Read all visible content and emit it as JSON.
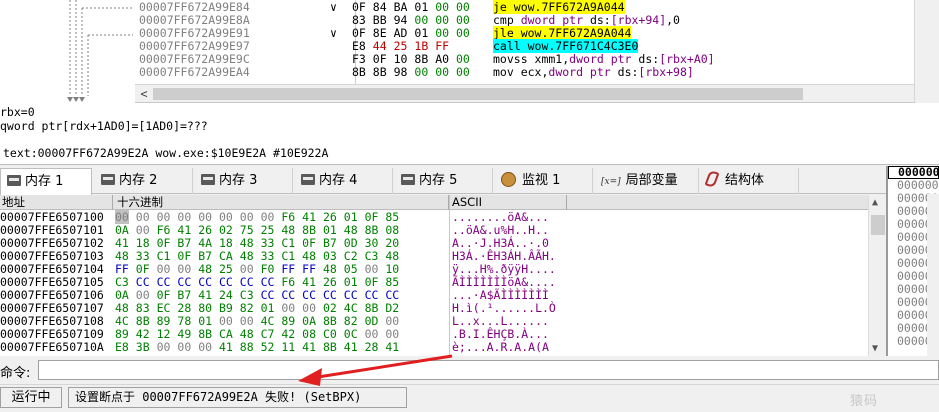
{
  "disasm": {
    "rows": [
      {
        "addr": "00007FF672A99E84",
        "arrow": "∨",
        "bytes": [
          {
            "t": "0F",
            "c": "b"
          },
          {
            "t": "84",
            "c": "b"
          },
          {
            "t": "BA",
            "c": "b"
          },
          {
            "t": "01",
            "c": "b"
          },
          {
            "t": "00",
            "c": "dz"
          },
          {
            "t": "00",
            "c": "dz"
          }
        ],
        "instr": [
          {
            "t": "je wow.7FF672A9A044",
            "c": "kw-jmp"
          }
        ]
      },
      {
        "addr": "00007FF672A99E8A",
        "arrow": "",
        "bytes": [
          {
            "t": "83",
            "c": "b"
          },
          {
            "t": "BB",
            "c": "b"
          },
          {
            "t": "94",
            "c": "b"
          },
          {
            "t": "00",
            "c": "dz"
          },
          {
            "t": "00",
            "c": "dz"
          },
          {
            "t": "00",
            "c": "dz"
          }
        ],
        "instr": [
          {
            "t": "cmp ",
            "c": ""
          },
          {
            "t": "dword ptr ",
            "c": "kw-ptr"
          },
          {
            "t": "ds:",
            "c": "kw-seg"
          },
          {
            "t": "[rbx+94]",
            "c": "kw-reg"
          },
          {
            "t": ",0",
            "c": ""
          }
        ]
      },
      {
        "addr": "00007FF672A99E91",
        "arrow": "∨",
        "bytes": [
          {
            "t": "0F",
            "c": "b"
          },
          {
            "t": "8E",
            "c": "b"
          },
          {
            "t": "AD",
            "c": "b"
          },
          {
            "t": "01",
            "c": "b"
          },
          {
            "t": "00",
            "c": "dz"
          },
          {
            "t": "00",
            "c": "dz"
          }
        ],
        "instr": [
          {
            "t": "jle wow.7FF672A9A044",
            "c": "kw-jmp"
          }
        ]
      },
      {
        "addr": "00007FF672A99E97",
        "arrow": "",
        "bytes": [
          {
            "t": "E8",
            "c": "b"
          },
          {
            "t": "44",
            "c": "hl"
          },
          {
            "t": "25",
            "c": "hl"
          },
          {
            "t": "1B",
            "c": "hl"
          },
          {
            "t": "FF",
            "c": "hl"
          }
        ],
        "instr": [
          {
            "t": "call wow.7FF671C4C3E0",
            "c": "kw-call"
          }
        ]
      },
      {
        "addr": "00007FF672A99E9C",
        "arrow": "",
        "bytes": [
          {
            "t": "F3",
            "c": "b"
          },
          {
            "t": "0F",
            "c": "b"
          },
          {
            "t": "10",
            "c": "b"
          },
          {
            "t": "8B",
            "c": "b"
          },
          {
            "t": "A0",
            "c": "b"
          },
          {
            "t": "00",
            "c": "dz"
          }
        ],
        "instr": [
          {
            "t": "movss xmm1,",
            "c": ""
          },
          {
            "t": "dword ptr ",
            "c": "kw-ptr"
          },
          {
            "t": "ds:",
            "c": "kw-seg"
          },
          {
            "t": "[rbx+A0]",
            "c": "kw-reg"
          }
        ]
      },
      {
        "addr": "00007FF672A99EA4",
        "arrow": "",
        "bytes": [
          {
            "t": "8B",
            "c": "b"
          },
          {
            "t": "8B",
            "c": "b"
          },
          {
            "t": "98",
            "c": "b"
          },
          {
            "t": "00",
            "c": "dz"
          },
          {
            "t": "00",
            "c": "dz"
          },
          {
            "t": "00",
            "c": "dz"
          }
        ],
        "instr": [
          {
            "t": "mov ecx,",
            "c": ""
          },
          {
            "t": "dword ptr ",
            "c": "kw-ptr"
          },
          {
            "t": "ds:",
            "c": "kw-seg"
          },
          {
            "t": "[rbx+98]",
            "c": "kw-reg"
          }
        ]
      }
    ],
    "scroll_left_arrow": "<"
  },
  "info": {
    "line1": "rbx=0",
    "line2": "qword ptr[rdx+1AD0]=[1AD0]=???",
    "line3": "text:00007FF672A99E2A wow.exe:$10E9E2A #10E922A"
  },
  "tabs": [
    {
      "label": "内存 1",
      "icon": "memory-icon",
      "active": true
    },
    {
      "label": "内存 2",
      "icon": "memory-icon",
      "active": false
    },
    {
      "label": "内存 3",
      "icon": "memory-icon",
      "active": false
    },
    {
      "label": "内存 4",
      "icon": "memory-icon",
      "active": false
    },
    {
      "label": "内存 5",
      "icon": "memory-icon",
      "active": false
    },
    {
      "label": "监视 1",
      "icon": "watch-icon",
      "active": false
    },
    {
      "label": "局部变量",
      "icon": "local-vars-icon",
      "active": false
    },
    {
      "label": "结构体",
      "icon": "struct-icon",
      "active": false
    }
  ],
  "tab_local_icon_text": "[x=]",
  "dump": {
    "headers": {
      "address": "地址",
      "hex": "十六进制",
      "ascii": "ASCII"
    },
    "rows": [
      {
        "addr": "00007FFE6507100",
        "hex": [
          "00",
          "00",
          "00",
          "00",
          "00",
          "00",
          "00",
          "00",
          "F6",
          "41",
          "26",
          "01",
          "0F",
          "85"
        ],
        "ascii": "........öA&..."
      },
      {
        "addr": "00007FFE6507101",
        "hex": [
          "0A",
          "00",
          "F6",
          "41",
          "26",
          "02",
          "75",
          "25",
          "48",
          "8B",
          "01",
          "48",
          "8B",
          "08"
        ],
        "ascii": "..öA&.u%H..H.."
      },
      {
        "addr": "00007FFE6507102",
        "hex": [
          "41",
          "18",
          "0F",
          "B7",
          "4A",
          "18",
          "48",
          "33",
          "C1",
          "0F",
          "B7",
          "0D",
          "30",
          "20"
        ],
        "ascii": "A..·J.H3Á..·.0 "
      },
      {
        "addr": "00007FFE6507103",
        "hex": [
          "48",
          "33",
          "C1",
          "0F",
          "B7",
          "CA",
          "48",
          "33",
          "C1",
          "48",
          "03",
          "C2",
          "C3",
          "48"
        ],
        "ascii": "H3Á.·ÊH3ÁH.ÂÃH."
      },
      {
        "addr": "00007FFE6507104",
        "hex": [
          "FF",
          "0F",
          "00",
          "00",
          "48",
          "25",
          "00",
          "F0",
          "FF",
          "FF",
          "48",
          "05",
          "00",
          "10"
        ],
        "ascii": "ÿ...H%.ðÿÿH...."
      },
      {
        "addr": "00007FFE6507105",
        "hex": [
          "C3",
          "CC",
          "CC",
          "CC",
          "CC",
          "CC",
          "CC",
          "CC",
          "F6",
          "41",
          "26",
          "01",
          "0F",
          "85"
        ],
        "ascii": "ÃÌÌÌÌÌÌÌöA&...."
      },
      {
        "addr": "00007FFE6507106",
        "hex": [
          "0A",
          "00",
          "0F",
          "B7",
          "41",
          "24",
          "C3",
          "CC",
          "CC",
          "CC",
          "CC",
          "CC",
          "CC",
          "CC"
        ],
        "ascii": "...·A$ÃÌÌÌÌÌÌÌ"
      },
      {
        "addr": "00007FFE6507107",
        "hex": [
          "48",
          "83",
          "EC",
          "28",
          "80",
          "B9",
          "82",
          "01",
          "00",
          "00",
          "02",
          "4C",
          "8B",
          "D2"
        ],
        "ascii": "H.ì(.¹......L.Ò"
      },
      {
        "addr": "00007FFE6507108",
        "hex": [
          "4C",
          "8B",
          "89",
          "78",
          "01",
          "00",
          "00",
          "4C",
          "89",
          "0A",
          "8B",
          "82",
          "0D",
          "00"
        ],
        "ascii": "L..x...L......"
      },
      {
        "addr": "00007FFE6507109",
        "hex": [
          "89",
          "42",
          "12",
          "49",
          "8B",
          "CA",
          "48",
          "C7",
          "42",
          "08",
          "C0",
          "0C",
          "00",
          "00"
        ],
        "ascii": ".B.I.ÊHÇB.À..."
      },
      {
        "addr": "00007FFE650710A",
        "hex": [
          "E8",
          "3B",
          "00",
          "00",
          "00",
          "41",
          "88",
          "52",
          "11",
          "41",
          "8B",
          "41",
          "28",
          "41"
        ],
        "ascii": "è;...A.R.A.A(A"
      }
    ]
  },
  "stack": {
    "rows": [
      "00000000",
      "00000000",
      "00000000",
      "00000000",
      "00000000",
      "00000000",
      "00000000",
      "00000000",
      "00000000",
      "00000000",
      "00000000",
      "00000000",
      "00000000",
      "00000000"
    ]
  },
  "command": {
    "label": "命令:",
    "value": "",
    "placeholder": ""
  },
  "status": {
    "state": "运行中",
    "message": "设置断点于 00007FF672A99E2A 失败! (SetBPX)"
  },
  "watermark": "猿码",
  "colors": {
    "annotation_arrow": "#e02020",
    "jump_highlight": "#ffff00",
    "call_highlight": "#00ffff"
  }
}
